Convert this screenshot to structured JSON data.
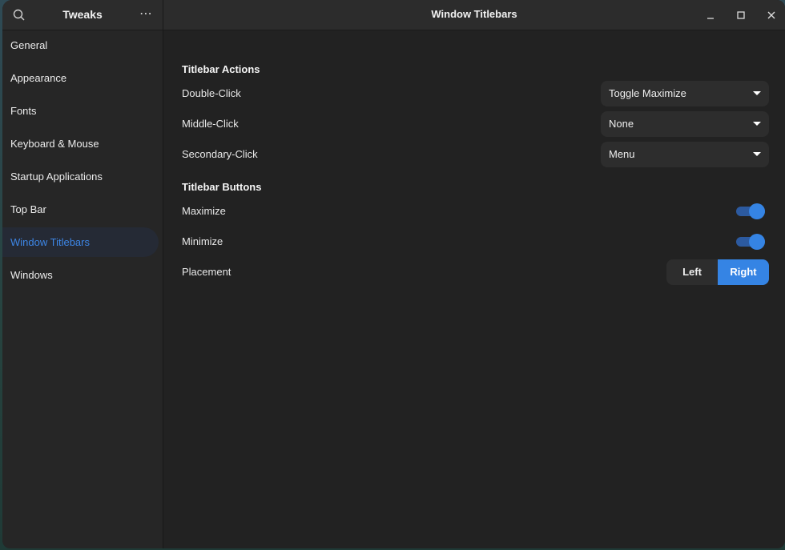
{
  "sidebar": {
    "title": "Tweaks",
    "search_icon": "search-icon",
    "menu_icon": "more-horizontal-icon",
    "menu_glyph": "⋯",
    "items": [
      {
        "label": "General",
        "active": false
      },
      {
        "label": "Appearance",
        "active": false
      },
      {
        "label": "Fonts",
        "active": false
      },
      {
        "label": "Keyboard & Mouse",
        "active": false
      },
      {
        "label": "Startup Applications",
        "active": false
      },
      {
        "label": "Top Bar",
        "active": false
      },
      {
        "label": "Window Titlebars",
        "active": true
      },
      {
        "label": "Windows",
        "active": false
      }
    ]
  },
  "header": {
    "title": "Window Titlebars",
    "controls": [
      "minimize-icon",
      "maximize-icon",
      "close-icon"
    ]
  },
  "titlebar_actions": {
    "section_title": "Titlebar Actions",
    "rows": [
      {
        "label": "Double-Click",
        "value": "Toggle Maximize"
      },
      {
        "label": "Middle-Click",
        "value": "None"
      },
      {
        "label": "Secondary-Click",
        "value": "Menu"
      }
    ]
  },
  "titlebar_buttons": {
    "section_title": "Titlebar Buttons",
    "maximize": {
      "label": "Maximize",
      "enabled": true
    },
    "minimize": {
      "label": "Minimize",
      "enabled": true
    },
    "placement": {
      "label": "Placement",
      "options": [
        "Left",
        "Right"
      ],
      "selected": "Right"
    }
  },
  "colors": {
    "accent": "#3584e4",
    "active_sidebar_text": "#3d86e6",
    "window_bg": "#222222",
    "header_bg": "#2c2c2c"
  }
}
